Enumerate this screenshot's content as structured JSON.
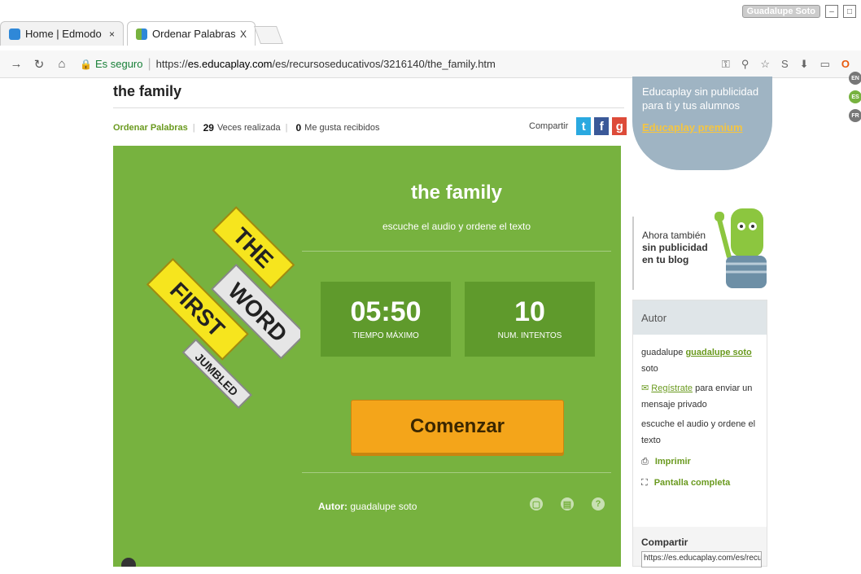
{
  "browser": {
    "tabs": [
      {
        "title": "Home | Edmodo",
        "close": "×"
      },
      {
        "title": "Ordenar Palabras the fan",
        "close": "X"
      }
    ],
    "user": "Guadalupe Soto",
    "secure_label": "Es seguro",
    "url_scheme": "https://",
    "url_host": "es.educaplay.com",
    "url_path": "/es/recursoseducativos/3216140/the_family.htm"
  },
  "page": {
    "title": "the family",
    "type_label": "Ordenar Palabras",
    "times_count": "29",
    "times_label": "Veces realizada",
    "likes_count": "0",
    "likes_label": "Me gusta recibidos",
    "share_label": "Compartir"
  },
  "game": {
    "title": "the family",
    "subtitle": "escuche el audio y ordene el texto",
    "max_time": "05:50",
    "max_time_label": "TIEMPO MÁXIMO",
    "attempts": "10",
    "attempts_label": "NUM. INTENTOS",
    "start_label": "Comenzar",
    "author_label": "Autor:",
    "author_name": "guadalupe soto",
    "logo_words": [
      "THE",
      "WORD",
      "FIRST",
      "JUMBLED"
    ]
  },
  "sidebar": {
    "promo_line1": "Educaplay sin publicidad para ti y tus alumnos",
    "promo_link": "Educaplay premium",
    "blog_line1": "Ahora también",
    "blog_line2": "sin publicidad",
    "blog_line3": "en tu blog",
    "author_header": "Autor",
    "author_first": "guadalupe",
    "author_link": "guadalupe soto",
    "author_last": "soto",
    "register_link": "Regístrate",
    "register_text": "para enviar un mensaje privado",
    "description": "escuche el audio y ordene el texto",
    "print_label": "Imprimir",
    "fullscreen_label": "Pantalla completa",
    "share_header": "Compartir",
    "share_url": "https://es.educaplay.com/es/recursose"
  },
  "languages": [
    "EN",
    "ES",
    "FR"
  ],
  "colors": {
    "game_bg": "#77b23f",
    "accent_green": "#6a9a1f",
    "start_button": "#f4a51a",
    "twitter": "#2aa9e0",
    "facebook": "#3b5998",
    "google": "#dd4b39"
  }
}
